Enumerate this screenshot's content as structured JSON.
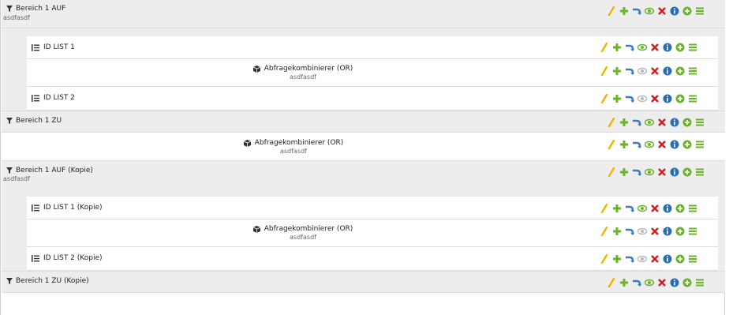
{
  "rows": [
    {
      "label": "Bereich 1 AUF",
      "sub": "asdfasdf"
    },
    {
      "label": "ID LIST 1"
    },
    {
      "label": "Abfragekombinierer (OR)",
      "sub": "asdfasdf"
    },
    {
      "label": "ID LIST 2"
    },
    {
      "label": "Bereich 1 ZU"
    },
    {
      "label": "Abfragekombinierer (OR)",
      "sub": "asdfasdf"
    },
    {
      "label": "Bereich 1 AUF (Kopie)",
      "sub": "asdfasdf"
    },
    {
      "label": "ID LIST 1 (Kopie)"
    },
    {
      "label": "Abfragekombinierer (OR)",
      "sub": "asdfasdf"
    },
    {
      "label": "ID LIST 2 (Kopie)"
    },
    {
      "label": "Bereich 1 ZU (Kopie)"
    }
  ],
  "icons": {
    "filter": "filter-icon",
    "list": "list-icon",
    "cube": "cube-icon",
    "actions": [
      "edit-icon",
      "add-icon",
      "move-icon",
      "visibility-icon",
      "delete-icon",
      "info-icon",
      "add-child-icon",
      "menu-icon"
    ]
  },
  "colors": {
    "grey_row": "#ededed",
    "edit": "#f0b400",
    "add": "#6ab42a",
    "move": "#3b7dc0",
    "eye_on": "#6ab42a",
    "eye_off": "#b9b9b9",
    "delete": "#cc2222",
    "info": "#2a6db5"
  }
}
